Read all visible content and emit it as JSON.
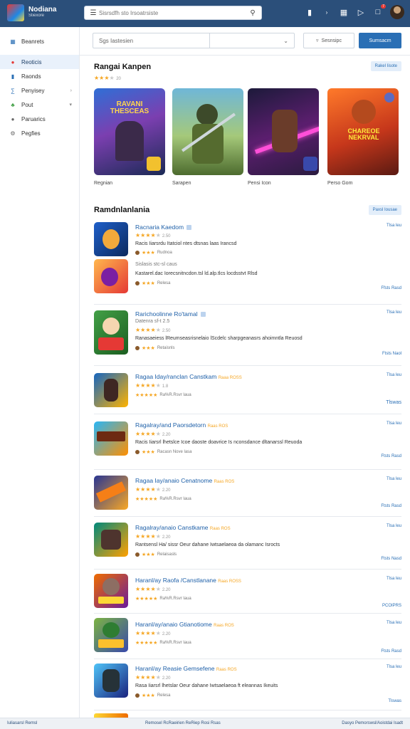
{
  "app": {
    "name": "Nodiana",
    "subtitle": "Stiexore"
  },
  "search": {
    "placeholder": "Sisrsdfh sto Irsoatrsiste"
  },
  "header": {
    "notif_count": "7"
  },
  "sidebar": {
    "items": [
      {
        "label": "Beanrets",
        "icon": "grid-icon"
      },
      {
        "label": "Reoticis",
        "icon": "gamepad-icon"
      },
      {
        "label": "Raonds",
        "icon": "bookmark-icon"
      },
      {
        "label": "Penyisey",
        "icon": "puzzle-icon"
      },
      {
        "label": "Pout",
        "icon": "leaf-icon"
      },
      {
        "label": "Paruarics",
        "icon": "people-icon"
      },
      {
        "label": "Pegfies",
        "icon": "settings-icon"
      }
    ]
  },
  "filters": {
    "select_a": "Sgs Iastesien",
    "select_b": "",
    "outline_button": "Sesnsipc",
    "primary_button": "Sumsacm"
  },
  "featured": {
    "title": "Rangai Kanpen",
    "rating_count": "20",
    "button": "Rakel Iisote",
    "items": [
      {
        "caption": "Regnian",
        "art_text": "RAVANI THESCEAS"
      },
      {
        "caption": "Sarapen",
        "art_text": ""
      },
      {
        "caption": "Pensi Icon",
        "art_text": ""
      },
      {
        "caption": "Perso Gom",
        "art_text": "CHAREOE NEKRVAL"
      }
    ]
  },
  "recommend": {
    "title": "Ramdnlanlania",
    "button": "Paxsl Iousae",
    "rows": [
      {
        "title": "Racnaria Kaedom",
        "rating": "2.50",
        "desc": "Racis Iiarsrdu Itatciol ntes dtsnas laas Irancsd",
        "meta": "Rudnoa",
        "right": "Tlsa leu",
        "sub_rating": "Sislasis stc-sl caus",
        "sub_desc": "Kastarel.dac Iorecsnitncdon.tsl ld.alp.tlcs locdsstvt Rlsd",
        "sub_meta": "Relesa",
        "sub_right": "Ffsts Rasd"
      },
      {
        "title": "Rarichoolinne Ro'tamal",
        "rating": "2.50",
        "desc": "Ranasaeiess lReumseasrisnelaio lScdelc sharpgeanasrs ahoimntla Reuosd",
        "meta": "Retaisnls",
        "right": "Tlsa leu",
        "sub_rating": "Datenra sf-t 2.5",
        "sub_right": "Ftsts Naol"
      },
      {
        "title": "Ragaa Iday/ranclan Canstkam",
        "rating": "1.8",
        "meta": "Ra%R.Rsvr laua",
        "right": "Tlsa leu",
        "extra": "Raaa ROSS",
        "foot": "Tlswas"
      },
      {
        "title": "Ragalray/and Paorsdetorn",
        "rating": "2.20",
        "desc": "Racis Iiarsrl lhetslce Icoe daoste doavrice Is nconsdance dltanarssl Reuoda",
        "meta": "Racasn Nove lasa",
        "right": "Tlsa leu",
        "extra": "Raas ROS",
        "foot": "Ftsts Rasd"
      },
      {
        "title": "Ragaa Iay/anaio Cenatnome",
        "rating": "2.20",
        "meta": "Ra%R.Rsvr laua",
        "right": "Tlsa leu",
        "extra": "Raas ROS",
        "foot": "Ftsts Rasd"
      },
      {
        "title": "Ragalray/anaio Canstkame",
        "rating": "2.20",
        "desc": "Rantsensl Ha/ sissr Oeur dahane Iwtsaelaeoa da olamanc Isrocts",
        "meta": "Relaisasls",
        "right": "Tlsa leu",
        "extra": "Raas ROS",
        "foot": "Ftsts Nasd"
      },
      {
        "title": "Haranl/ay Raofa /Canstlanane",
        "rating": "2.20",
        "meta": "Ra%R.Rsvr laua",
        "right": "Tlsa leu",
        "extra": "Raas ROSS",
        "foot": "PCOIPRS"
      },
      {
        "title": "Haranl/ay/anaio Gtianotiome",
        "rating": "2.20",
        "meta": "Ra%R.Rsvr laua",
        "right": "Tlsa leu",
        "extra": "Raas ROS",
        "foot": "Ftsts Rasd"
      },
      {
        "title": "Haranl/ay Reasie Gemsefene",
        "rating": "2.20",
        "desc": "Rasa Iiarsrl lhetslar Oeur dahane Iwtsaelaeoa ft eleannas Ikeuits",
        "meta": "Relesa",
        "right": "Tlsa leu",
        "extra": "Raas ROS",
        "foot": "Tlswas"
      }
    ]
  },
  "footer": {
    "left": "Iuliasarsl Remsl",
    "center": "Remosel RcRaeirien ReRiep Rosi Rsas",
    "right": "Dasyo Pemorswsl/Aoistdai Isadt"
  }
}
